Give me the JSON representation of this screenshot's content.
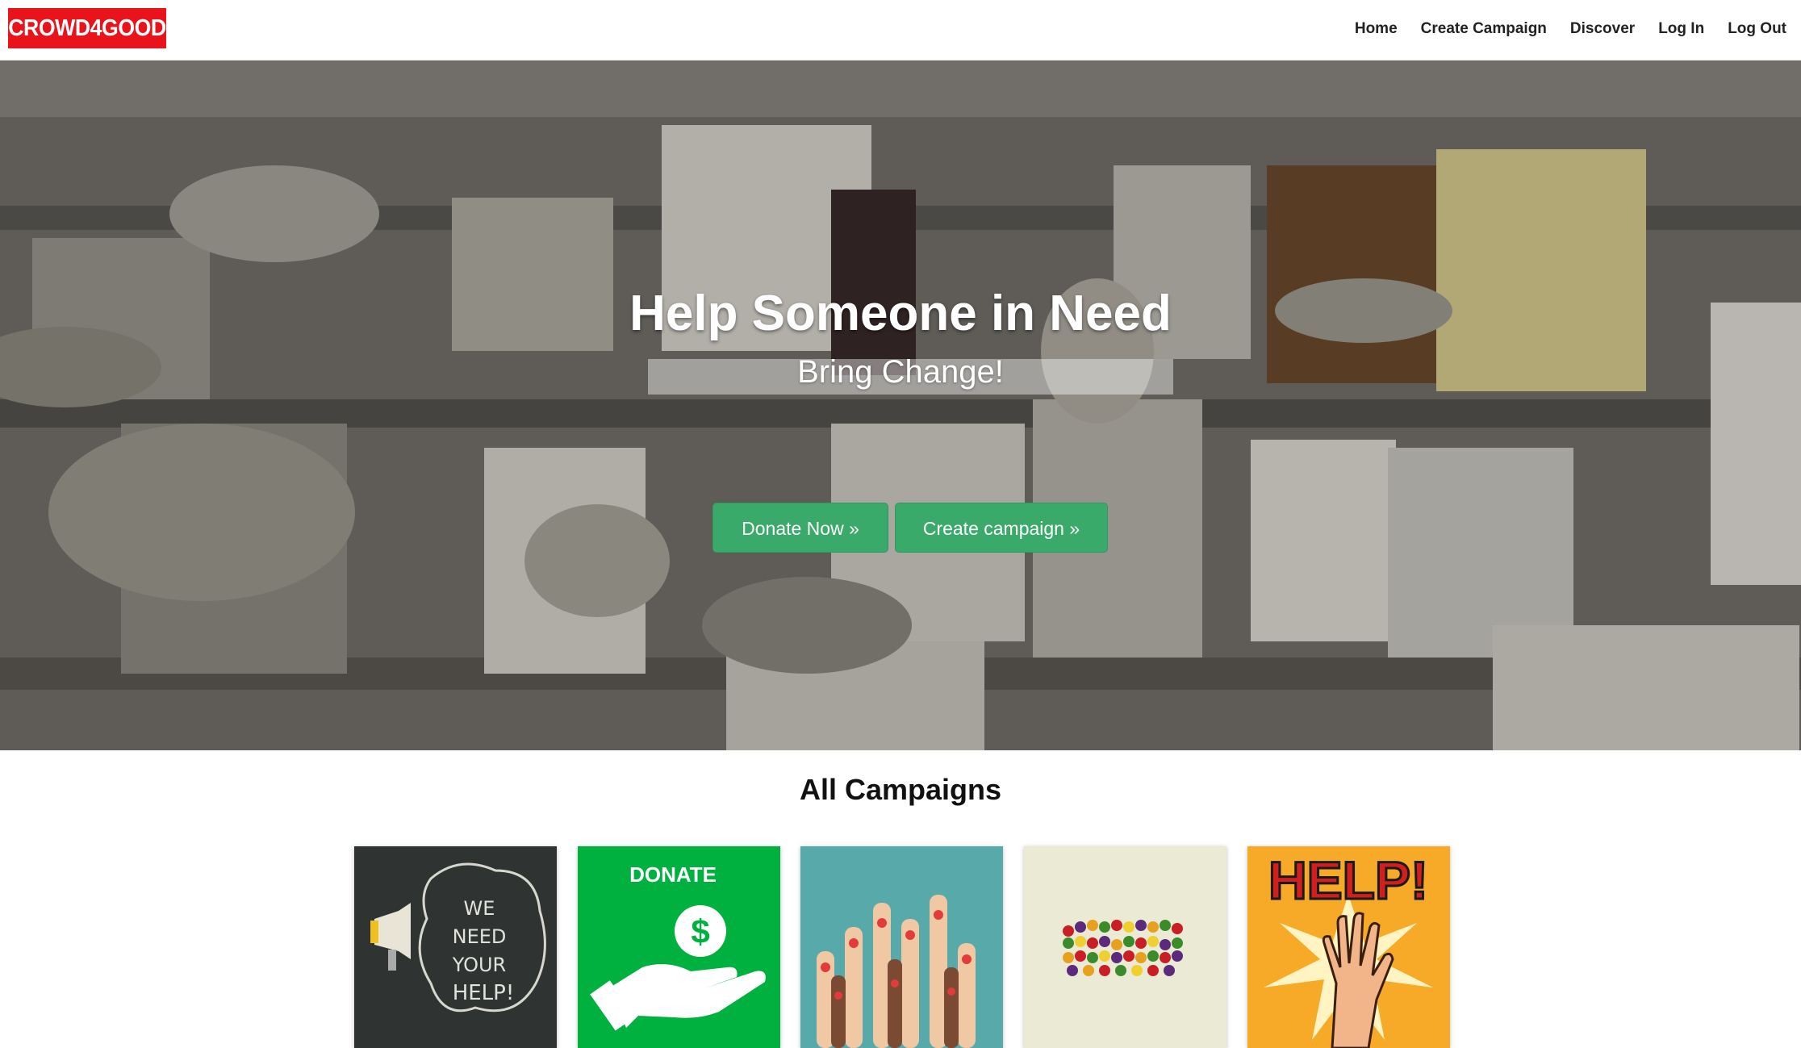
{
  "brand": {
    "logo_text": "CROWD4GOOD",
    "color": "#e8131b"
  },
  "nav": {
    "links": [
      "Home",
      "Create Campaign",
      "Discover",
      "Log In",
      "Log Out"
    ]
  },
  "hero": {
    "title": "Help Someone in Need",
    "subtitle": "Bring Change!",
    "donate_button": "Donate Now »",
    "create_button": "Create campaign »",
    "button_color": "#3aaa6a"
  },
  "campaigns": {
    "heading": "All Campaigns",
    "cards": [
      {
        "image_text": "WE NEED YOUR HELP!",
        "icon": "megaphone-icon"
      },
      {
        "image_text": "DONATE",
        "icon": "hand-dollar-icon"
      },
      {
        "image_text": "",
        "icon": "raised-hands-icon"
      },
      {
        "image_text": "",
        "icon": "candy-letters-icon"
      },
      {
        "image_text": "HELP!",
        "icon": "help-hand-icon"
      }
    ]
  }
}
